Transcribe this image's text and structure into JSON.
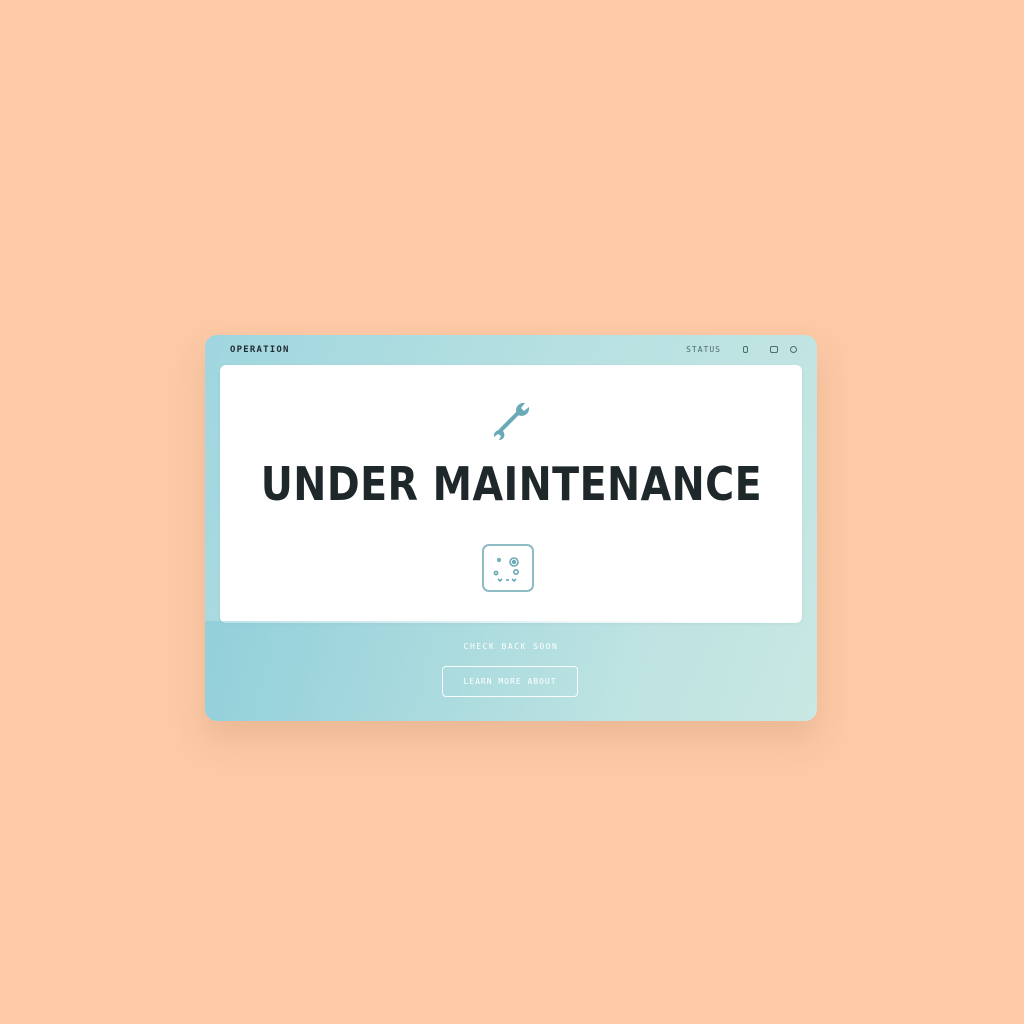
{
  "window": {
    "title": "OPERATION",
    "title_right_text": "STATUS",
    "controls": [
      "minimize",
      "maximize",
      "close"
    ]
  },
  "panel": {
    "icon": "wrench-icon",
    "heading": "UNDER MAINTENANCE",
    "status_icon": "gears-icon"
  },
  "footer": {
    "caption": "CHECK BACK SOON",
    "button_label": "LEARN MORE ABOUT"
  },
  "colors": {
    "background": "#fdc9a6",
    "window_accent": "#9fd6df",
    "icon_stroke": "#6aa9b8",
    "heading": "#1e2729"
  }
}
